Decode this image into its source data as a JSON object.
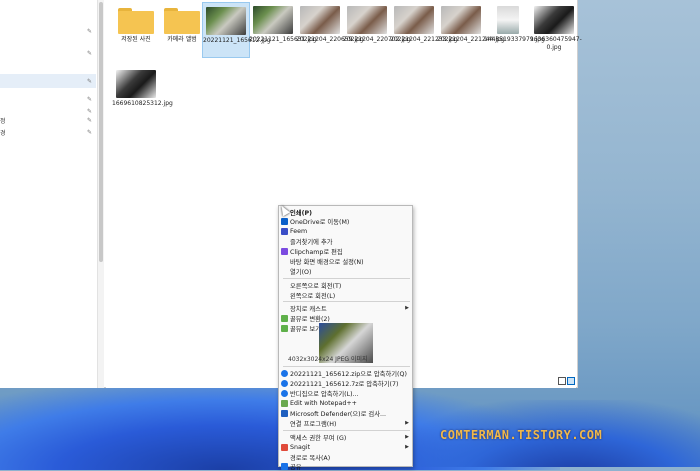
{
  "nav": {
    "items": [
      {
        "label": "",
        "pinned": true
      },
      {
        "label": "",
        "pinned": true
      },
      {
        "label": "",
        "pinned": true
      },
      {
        "label": "",
        "pinned": true
      },
      {
        "label": "",
        "pinned": true
      },
      {
        "label": "정",
        "pinned": true
      },
      {
        "label": "경",
        "pinned": true
      }
    ]
  },
  "files": [
    {
      "name": "저장된 사진",
      "kind": "folder"
    },
    {
      "name": "카메라 앨범",
      "kind": "folder"
    },
    {
      "name": "20221121_165612.jpg",
      "kind": "cat",
      "selected": true
    },
    {
      "name": "20221121_165631.jpg",
      "kind": "cat"
    },
    {
      "name": "20221204_220659.jpg",
      "kind": "hand"
    },
    {
      "name": "20221204_220702.jpg",
      "kind": "hand"
    },
    {
      "name": "20221204_221233.jpg",
      "kind": "hand"
    },
    {
      "name": "20221204_221244.jpg",
      "kind": "hand"
    },
    {
      "name": "1448519337979.jpg",
      "kind": "phone"
    },
    {
      "name": "1636360475947-0.jpg",
      "kind": "cam"
    },
    {
      "name": "1669610825312.jpg",
      "kind": "cam"
    }
  ],
  "context_menu": {
    "items": [
      {
        "label": "인쇄(P)",
        "bold": true
      },
      {
        "label": "OneDrive로 이동(M)",
        "icon_color": "#0a5fc9"
      },
      {
        "label": "Feem",
        "icon_color": "#3a4ec7"
      },
      {
        "label": "즐겨찾기에 추가"
      },
      {
        "label": "Clipchamp로 편집",
        "icon_color": "#7b4be0"
      },
      {
        "label": "바탕 화면 배경으로 설정(N)"
      },
      {
        "label": "열기(O)"
      },
      {
        "label": "오른쪽으로 회전(T)"
      },
      {
        "label": "왼쪽으로 회전(L)"
      },
      {
        "label": "장치로 캐스트",
        "submenu": true
      },
      {
        "label": "꿀뷰로 변환(2)",
        "icon_color": "#5fb04a"
      },
      {
        "label": "꿀뷰로 보기(1)",
        "icon_color": "#5fb04a"
      },
      {
        "label": "20221121_165612.zip으로 압축하기(Q)",
        "icon_color": "#1a73e8"
      },
      {
        "label": "20221121_165612.7z로 압축하기(7)",
        "icon_color": "#1a73e8"
      },
      {
        "label": "반디집으로 압축하기(L)...",
        "icon_color": "#1a73e8"
      },
      {
        "label": "Edit with Notepad++",
        "icon_color": "#6aa84f"
      },
      {
        "label": "Microsoft Defender(으)로 검사...",
        "icon_color": "#1f5fbf"
      },
      {
        "label": "연결 프로그램(H)",
        "submenu": true
      },
      {
        "label": "액세스 권한 부여 (G)",
        "submenu": true
      },
      {
        "label": "Snagit",
        "icon_color": "#e04a3a",
        "submenu": true
      },
      {
        "label": "경로로 복사(A)"
      },
      {
        "label": "공유",
        "icon_color": "#1a73e8"
      }
    ],
    "preview_caption": "4032x3024x24 JPEG 이미지"
  },
  "watermark": "COMTERMAN.TISTORY.COM"
}
